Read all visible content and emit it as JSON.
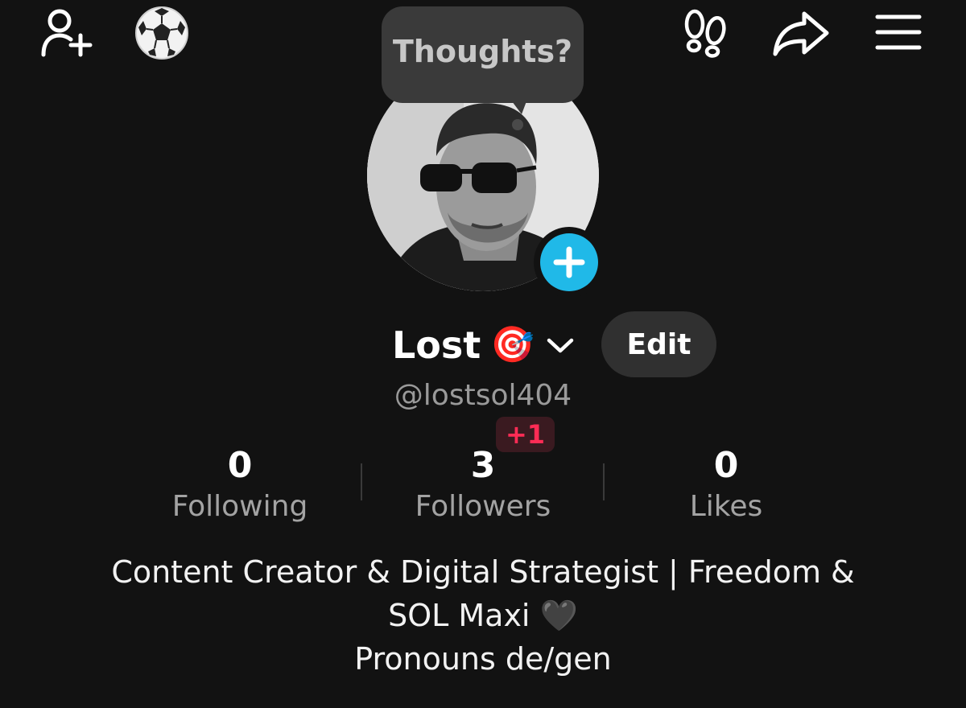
{
  "header": {
    "icons": {
      "add_friend": "person-plus-icon",
      "soccer": "soccer-ball-icon",
      "footprints": "footprints-icon",
      "share": "share-icon",
      "menu": "hamburger-menu-icon"
    }
  },
  "profile": {
    "bubble_text": "Thoughts?",
    "name": "Lost",
    "name_emoji": "🎯",
    "edit_label": "Edit",
    "handle": "@lostsol404",
    "new_followers_badge": "+1"
  },
  "stats": [
    {
      "value": "0",
      "label": "Following"
    },
    {
      "value": "3",
      "label": "Followers"
    },
    {
      "value": "0",
      "label": "Likes"
    }
  ],
  "bio": {
    "line1": "Content Creator & Digital Strategist | Freedom &",
    "line2": "SOL Maxi 🖤",
    "line3": "Pronouns de/gen"
  },
  "colors": {
    "background": "#121212",
    "accent_blue": "#20b9e8",
    "badge_red": "#fe2c55"
  }
}
